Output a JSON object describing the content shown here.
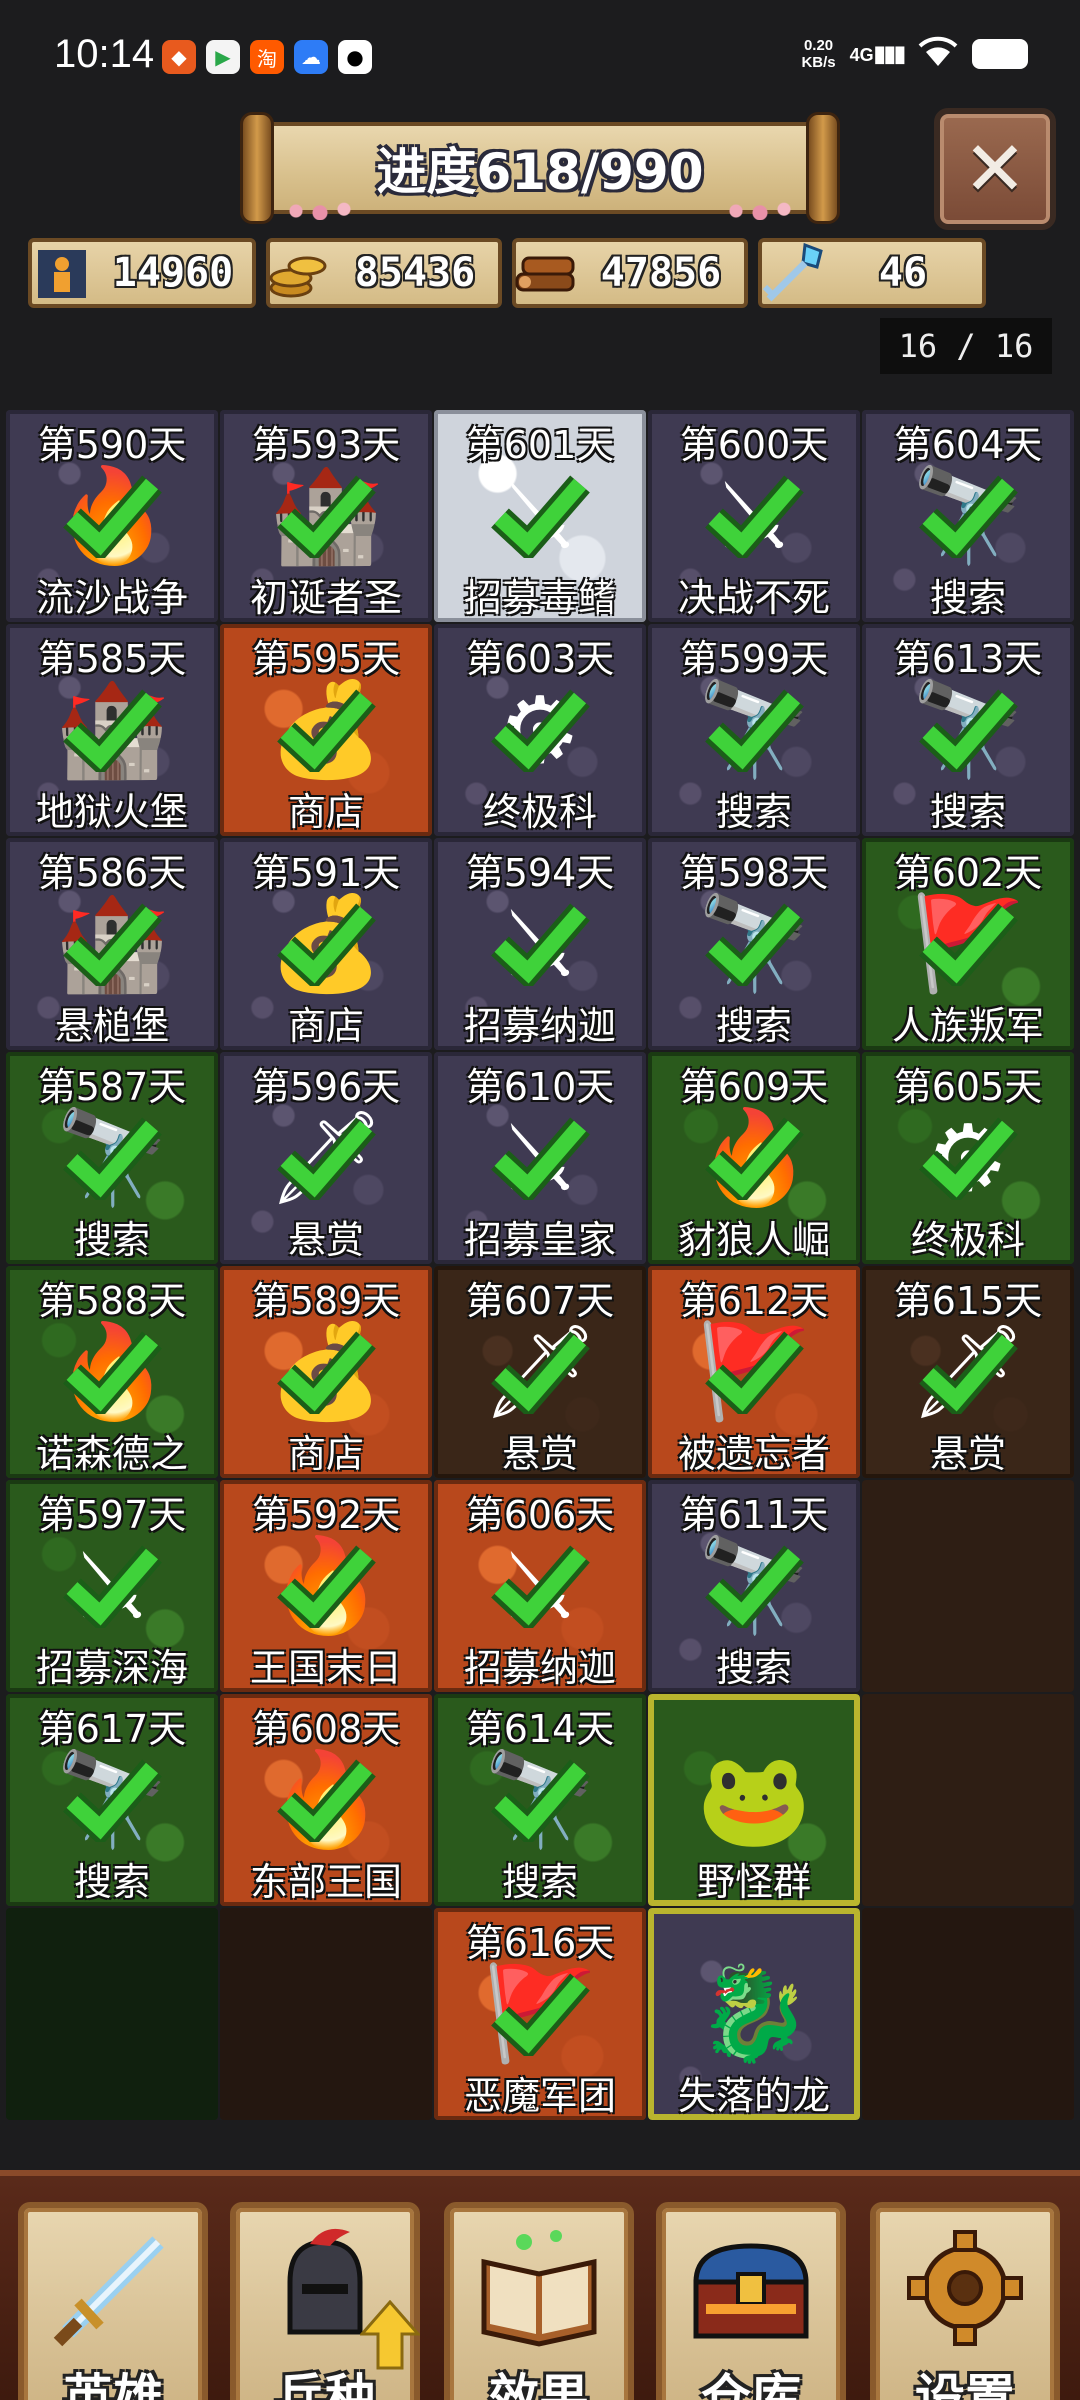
{
  "status_bar": {
    "time": "10:14",
    "speed_value": "0.20",
    "speed_unit": "KB/s",
    "network": "4G",
    "app_icons": [
      "shopping-app-icon",
      "video-app-icon",
      "taobao-icon",
      "cloud-app-icon",
      "qq-icon"
    ],
    "taobao_label": "淘"
  },
  "header": {
    "progress_title": "进度618/990",
    "close_icon": "close-icon"
  },
  "resources": [
    {
      "icon": "population-icon",
      "value": "14960"
    },
    {
      "icon": "gold-coins-icon",
      "value": "85436"
    },
    {
      "icon": "wood-logs-icon",
      "value": "47856"
    },
    {
      "icon": "crystal-key-icon",
      "value": "46"
    }
  ],
  "page_indicator": "16 / 16",
  "grid": {
    "cells": [
      {
        "day": "第590天",
        "name": "流沙战争",
        "terrain": "stone",
        "art": "fire-orb-icon",
        "done": true
      },
      {
        "day": "第593天",
        "name": "初诞者圣",
        "terrain": "stone",
        "art": "portal-icon",
        "done": true
      },
      {
        "day": "第601天",
        "name": "招募毒鳍",
        "terrain": "snow",
        "art": "crossed-axes-icon",
        "done": true
      },
      {
        "day": "第600天",
        "name": "决战不死",
        "terrain": "stone",
        "art": "crossed-swords-icon",
        "done": true
      },
      {
        "day": "第604天",
        "name": "搜索",
        "terrain": "stone",
        "art": "spyglass-icon",
        "done": true
      },
      {
        "day": "第585天",
        "name": "地狱火堡",
        "terrain": "stone",
        "art": "portal-icon",
        "done": true
      },
      {
        "day": "第595天",
        "name": "商店",
        "terrain": "lava",
        "art": "treasure-bag-icon",
        "done": true
      },
      {
        "day": "第603天",
        "name": "终极科",
        "terrain": "stone",
        "art": "gear-icon",
        "done": true
      },
      {
        "day": "第599天",
        "name": "搜索",
        "terrain": "stone",
        "art": "spyglass-icon",
        "done": true
      },
      {
        "day": "第613天",
        "name": "搜索",
        "terrain": "stone",
        "art": "spyglass-icon",
        "done": true
      },
      {
        "day": "第586天",
        "name": "悬槌堡",
        "terrain": "stone",
        "art": "portal-icon",
        "done": true
      },
      {
        "day": "第591天",
        "name": "商店",
        "terrain": "stone",
        "art": "treasure-bag-icon",
        "done": true
      },
      {
        "day": "第594天",
        "name": "招募纳迦",
        "terrain": "stone",
        "art": "crossed-axes-icon",
        "done": true
      },
      {
        "day": "第598天",
        "name": "搜索",
        "terrain": "stone",
        "art": "spyglass-icon",
        "done": true
      },
      {
        "day": "第602天",
        "name": "人族叛军",
        "terrain": "grass",
        "art": "banner-icon",
        "done": true
      },
      {
        "day": "第587天",
        "name": "搜索",
        "terrain": "grass",
        "art": "spyglass-icon",
        "done": true
      },
      {
        "day": "第596天",
        "name": "悬赏",
        "terrain": "stone",
        "art": "dagger-icon",
        "done": true
      },
      {
        "day": "第610天",
        "name": "招募皇家",
        "terrain": "stone",
        "art": "crossed-axes-icon",
        "done": true
      },
      {
        "day": "第609天",
        "name": "豺狼人崛",
        "terrain": "grass",
        "art": "fire-orb-icon",
        "done": true
      },
      {
        "day": "第605天",
        "name": "终极科",
        "terrain": "grass",
        "art": "gear-icon",
        "done": true
      },
      {
        "day": "第588天",
        "name": "诺森德之",
        "terrain": "grass",
        "art": "fire-orb-icon",
        "done": true
      },
      {
        "day": "第589天",
        "name": "商店",
        "terrain": "lava",
        "art": "treasure-bag-icon",
        "done": true
      },
      {
        "day": "第607天",
        "name": "悬赏",
        "terrain": "dirt",
        "art": "dagger-icon",
        "done": true
      },
      {
        "day": "第612天",
        "name": "被遗忘者",
        "terrain": "lava",
        "art": "banner-icon",
        "done": true
      },
      {
        "day": "第615天",
        "name": "悬赏",
        "terrain": "dirt",
        "art": "dagger-icon",
        "done": true
      },
      {
        "day": "第597天",
        "name": "招募深海",
        "terrain": "grass",
        "art": "crossed-axes-icon",
        "done": true
      },
      {
        "day": "第592天",
        "name": "王国末日",
        "terrain": "lava",
        "art": "fire-orb-icon",
        "done": true
      },
      {
        "day": "第606天",
        "name": "招募纳迦",
        "terrain": "lava",
        "art": "crossed-axes-icon",
        "done": true
      },
      {
        "day": "第611天",
        "name": "搜索",
        "terrain": "stone",
        "art": "spyglass-icon",
        "done": true
      },
      {
        "day": "",
        "name": "",
        "terrain": "darkdirt",
        "art": "",
        "done": false
      },
      {
        "day": "第617天",
        "name": "搜索",
        "terrain": "grass",
        "art": "spyglass-icon",
        "done": true
      },
      {
        "day": "第608天",
        "name": "东部王国",
        "terrain": "lava",
        "art": "fire-orb-icon",
        "done": true
      },
      {
        "day": "第614天",
        "name": "搜索",
        "terrain": "grass",
        "art": "spyglass-icon",
        "done": true
      },
      {
        "day": "",
        "name": "野怪群",
        "terrain": "grass",
        "art": "murloc-icon",
        "done": false,
        "highlight": true
      },
      {
        "day": "",
        "name": "",
        "terrain": "darkdirt",
        "art": "",
        "done": false
      },
      {
        "day": "",
        "name": "",
        "terrain": "dimgrass",
        "art": "",
        "done": false
      },
      {
        "day": "",
        "name": "",
        "terrain": "dimdirt",
        "art": "",
        "done": false
      },
      {
        "day": "第616天",
        "name": "恶魔军团",
        "terrain": "lava",
        "art": "banner-icon",
        "done": true
      },
      {
        "day": "",
        "name": "失落的龙",
        "terrain": "stone",
        "art": "dragon-icon",
        "done": false,
        "highlight": true
      },
      {
        "day": "",
        "name": "",
        "terrain": "dimdirt",
        "art": "",
        "done": false
      }
    ]
  },
  "bottom_nav": [
    {
      "label": "英雄",
      "icon": "sword-icon"
    },
    {
      "label": "兵种",
      "icon": "knight-helmet-icon",
      "badge": "up-arrow-icon"
    },
    {
      "label": "效果",
      "icon": "spellbook-icon"
    },
    {
      "label": "仓库",
      "icon": "treasure-chest-icon"
    },
    {
      "label": "设置",
      "icon": "gear-icon"
    }
  ],
  "colors": {
    "background": "#1c1c1e",
    "parchment": "#e7d3a8",
    "check_green": "#3fd23a",
    "highlight_border": "#b9b52e"
  }
}
